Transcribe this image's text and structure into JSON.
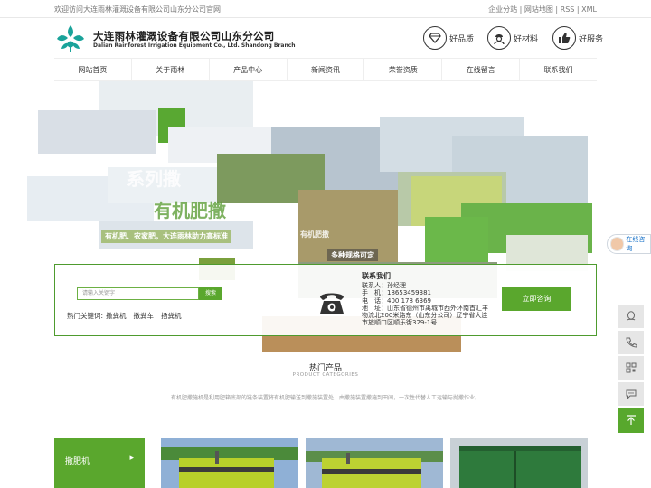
{
  "topbar": {
    "welcome": "欢迎访问大连雨林灌溉设备有限公司山东分公司官网!",
    "links": [
      "企业分站",
      "网站地图",
      "RSS",
      "XML"
    ],
    "separator": " | "
  },
  "header": {
    "company_cn": "大连雨林灌溉设备有限公司山东分公司",
    "company_en": "Dalian Rainforest Irrigation Equipment Co., Ltd. Shandong Branch",
    "features": [
      {
        "label": "好品质",
        "icon": "diamond-icon"
      },
      {
        "label": "好材料",
        "icon": "worker-icon"
      },
      {
        "label": "好服务",
        "icon": "thumbs-up-icon"
      }
    ]
  },
  "nav": {
    "items": [
      "网站首页",
      "关于雨林",
      "产品中心",
      "新闻资讯",
      "荣誉资质",
      "在线留言",
      "联系我们"
    ]
  },
  "banner": {
    "text_series": "系列撒",
    "text_organic": "有机肥撒",
    "text_slogan": "有机肥、农家肥，大连雨林助力高标准",
    "text_product": "多种规格可定",
    "text_small": "有机肥撒"
  },
  "float_cs": {
    "label": "在线咨询"
  },
  "search": {
    "placeholder": "请输入关键字",
    "button": "搜索",
    "hot_label": "热门关键词:",
    "hot_keywords": [
      "撒粪机",
      "撒粪车",
      "扬粪机"
    ]
  },
  "contact": {
    "title": "联系我们",
    "person": "联系人：孙经理",
    "mobile": "手　机：18653459381",
    "phone": "电　话：400 178 6369",
    "address": "地　址：山东省德州市禹城市西外环南首汇丰物流北200米路东（山东分公司）辽宁省大连市旅顺口区顺乐街329-1号"
  },
  "consult_button": "立即咨询",
  "sidebar": {
    "icons": [
      "qq-icon",
      "phone-icon",
      "qrcode-icon",
      "message-icon",
      "top-icon"
    ]
  },
  "section": {
    "title": "热门产品",
    "subtitle": "PRODUCT CATEGORIES",
    "desc": "有机肥撒施机是利用肥箱底部的链条装置将有机肥输送到撒施装置处，由撒施装置撒施到田间，一次性代替人工运输与抛撒作业。"
  },
  "category": {
    "label": "撒肥机",
    "arrow": "▸"
  },
  "colors": {
    "brand_green": "#5aa72d",
    "text": "#333333",
    "light_gray": "#e6e6e6"
  }
}
